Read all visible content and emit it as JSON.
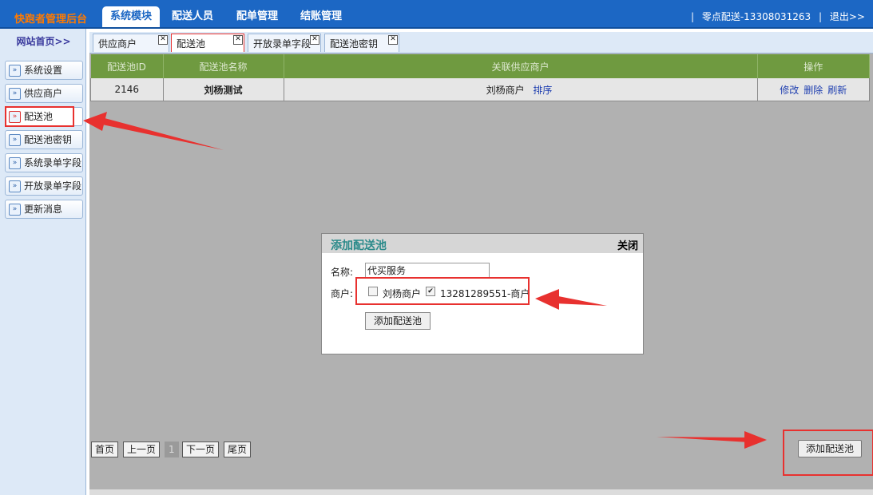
{
  "header": {
    "brand": "快跑者管理后台",
    "nav": [
      "系统模块",
      "配送人员",
      "配单管理",
      "结账管理"
    ],
    "user": "零点配送-13308031263",
    "logout": "退出>>",
    "separator": "|"
  },
  "sidebar": {
    "home": "网站首页>>",
    "items": [
      "系统设置",
      "供应商户",
      "配送池",
      "配送池密钥",
      "系统录单字段",
      "开放录单字段",
      "更新消息"
    ]
  },
  "page_tabs": [
    "供应商户",
    "配送池",
    "开放录单字段",
    "配送池密钥"
  ],
  "table": {
    "headers": [
      "配送池ID",
      "配送池名称",
      "关联供应商户",
      "操作"
    ],
    "rows": [
      {
        "id": "2146",
        "name": "刘杨测试",
        "merchant": "刘杨商户",
        "sort": "排序",
        "actions": [
          "修改",
          "删除",
          "刷新"
        ]
      }
    ]
  },
  "pager": {
    "first": "首页",
    "prev": "上一页",
    "current": "1",
    "next": "下一页",
    "last": "尾页"
  },
  "add_button": "添加配送池",
  "modal": {
    "title": "添加配送池",
    "close": "关闭",
    "name_label": "名称:",
    "name_value": "代买服务",
    "merchant_label": "商户:",
    "merchants": [
      {
        "label": "刘杨商户",
        "checked": false
      },
      {
        "label": "13281289551-商户",
        "checked": true
      }
    ],
    "submit": "添加配送池"
  },
  "colors": {
    "topbar": "#1c67c4",
    "brand": "#ff7a00",
    "table_header": "#6f9a40",
    "annotation": "#e8312f"
  }
}
